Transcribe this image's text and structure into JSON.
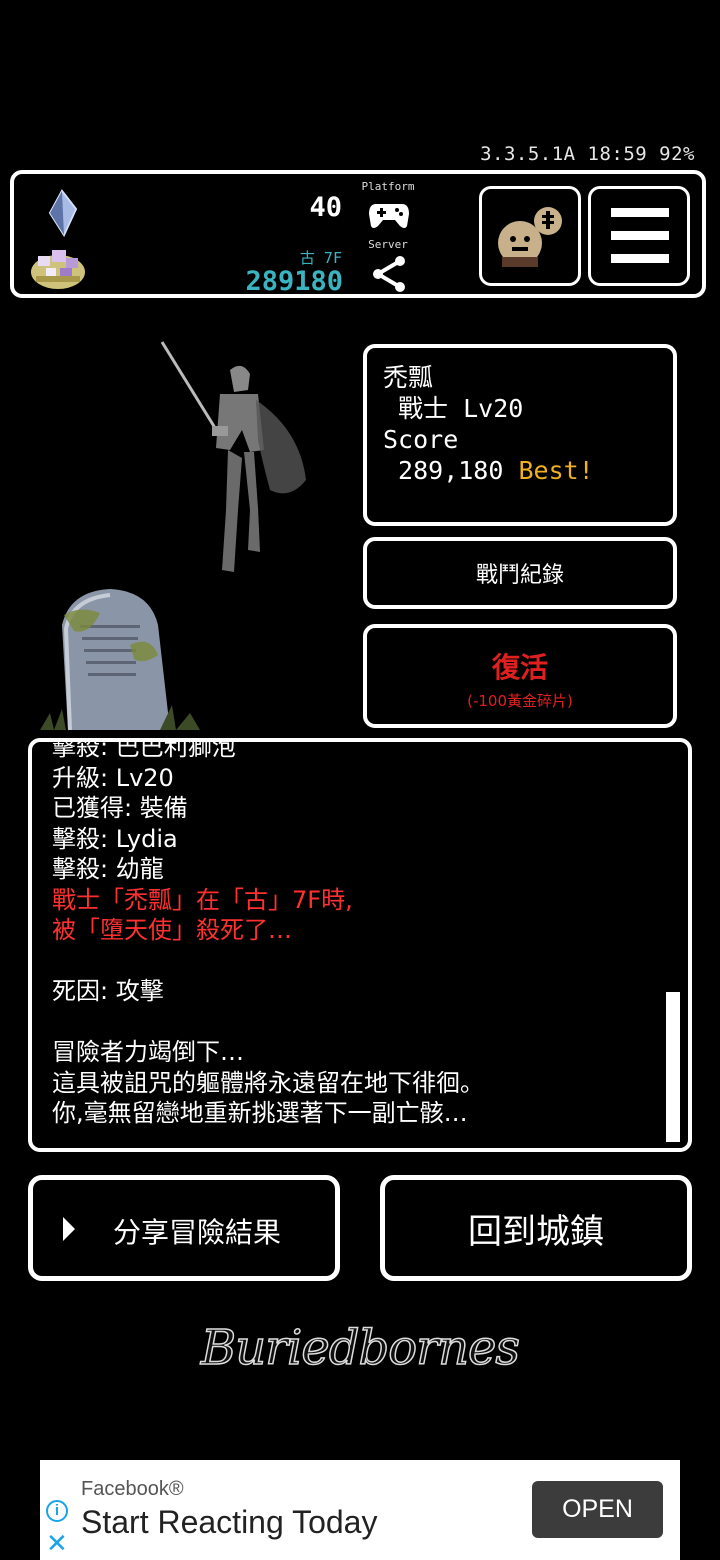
{
  "status": {
    "version_time_battery": "3.3.5.1A 18:59 92%"
  },
  "top_bar": {
    "gem_count": "40",
    "floor": "古 7F",
    "gold_count": "289180",
    "platform_label": "Platform",
    "server_label": "Server"
  },
  "character": {
    "name": "禿瓢",
    "class_level": " 戰士 Lv20",
    "score_label": "Score",
    "score_value": " 289,180 ",
    "best_label": "Best!"
  },
  "buttons": {
    "battle_record": "戰鬥紀錄",
    "revive": "復活",
    "revive_cost": "(-100黃金碎片)",
    "share_result": "分享冒險結果",
    "return_town": "回到城鎮"
  },
  "log": {
    "lines": [
      {
        "text": "擊殺: 巴巴利獅泡",
        "color": "white"
      },
      {
        "text": "升級: Lv20",
        "color": "white"
      },
      {
        "text": "已獲得: 裝備",
        "color": "white"
      },
      {
        "text": "擊殺: Lydia",
        "color": "white"
      },
      {
        "text": "擊殺: 幼龍",
        "color": "white"
      },
      {
        "text": "戰士「禿瓢」在「古」7F時,",
        "color": "red"
      },
      {
        "text": "被「墮天使」殺死了…",
        "color": "red"
      },
      {
        "text": "",
        "color": "white"
      },
      {
        "text": "死因: 攻擊",
        "color": "white"
      },
      {
        "text": "",
        "color": "white"
      },
      {
        "text": "冒險者力竭倒下…",
        "color": "white"
      },
      {
        "text": "這具被詛咒的軀體將永遠留在地下徘徊。",
        "color": "white"
      },
      {
        "text": "你,毫無留戀地重新挑選著下一副亡骸…",
        "color": "white"
      }
    ]
  },
  "logo": {
    "text": "Buriedbornes"
  },
  "ad": {
    "sponsor": "Facebook®",
    "headline": "Start Reacting Today",
    "cta": "OPEN"
  },
  "colors": {
    "accent_cyan": "#3bb4c2",
    "danger_red": "#e02020",
    "best_gold": "#f0b020"
  }
}
